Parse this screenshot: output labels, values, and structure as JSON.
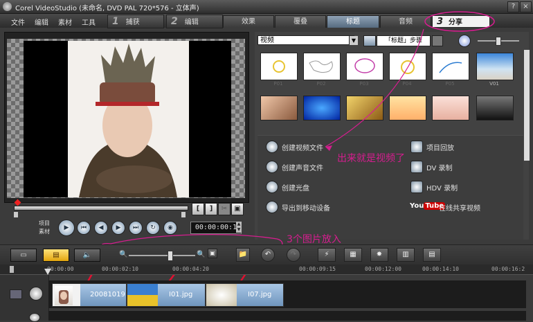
{
  "window": {
    "title": "Corel VideoStudio (未命名, DVD PAL 720*576 - 立体声)",
    "buttons": [
      "?",
      "×"
    ]
  },
  "menu": [
    "文件",
    "编辑",
    "素材",
    "工具"
  ],
  "steps": [
    {
      "num": "1",
      "label": "捕获"
    },
    {
      "num": "2",
      "label": "编辑"
    },
    {
      "num": "3",
      "label": "分享"
    }
  ],
  "tabs": [
    "效果",
    "覆叠",
    "标题",
    "音频"
  ],
  "player": {
    "labels": [
      "项目",
      "素材"
    ],
    "timecode": "00:00:00:1"
  },
  "library": {
    "category": "视频",
    "field": "「标题」步骤",
    "thumbs": [
      "P01",
      "P02",
      "P03",
      "P04",
      "P05",
      "V01"
    ]
  },
  "share": {
    "left": [
      "创建视频文件",
      "创建声音文件",
      "创建光盘",
      "导出到移动设备"
    ],
    "right": [
      "项目回放",
      "DV 录制",
      "HDV 录制",
      "在线共享视频"
    ],
    "youtube": "You Tube"
  },
  "annotations": {
    "video_note": "出来就是视频了",
    "images_note": "3个图片放入"
  },
  "timeline": {
    "ticks": [
      "00:00:00",
      "00:00:02:10",
      "00:00:04:20",
      "00:00:09:15",
      "00:00:12:00",
      "00:00:14:10",
      "00:00:16:2"
    ],
    "clips": [
      "20081019",
      "I01.jpg",
      "I07.jpg"
    ]
  }
}
